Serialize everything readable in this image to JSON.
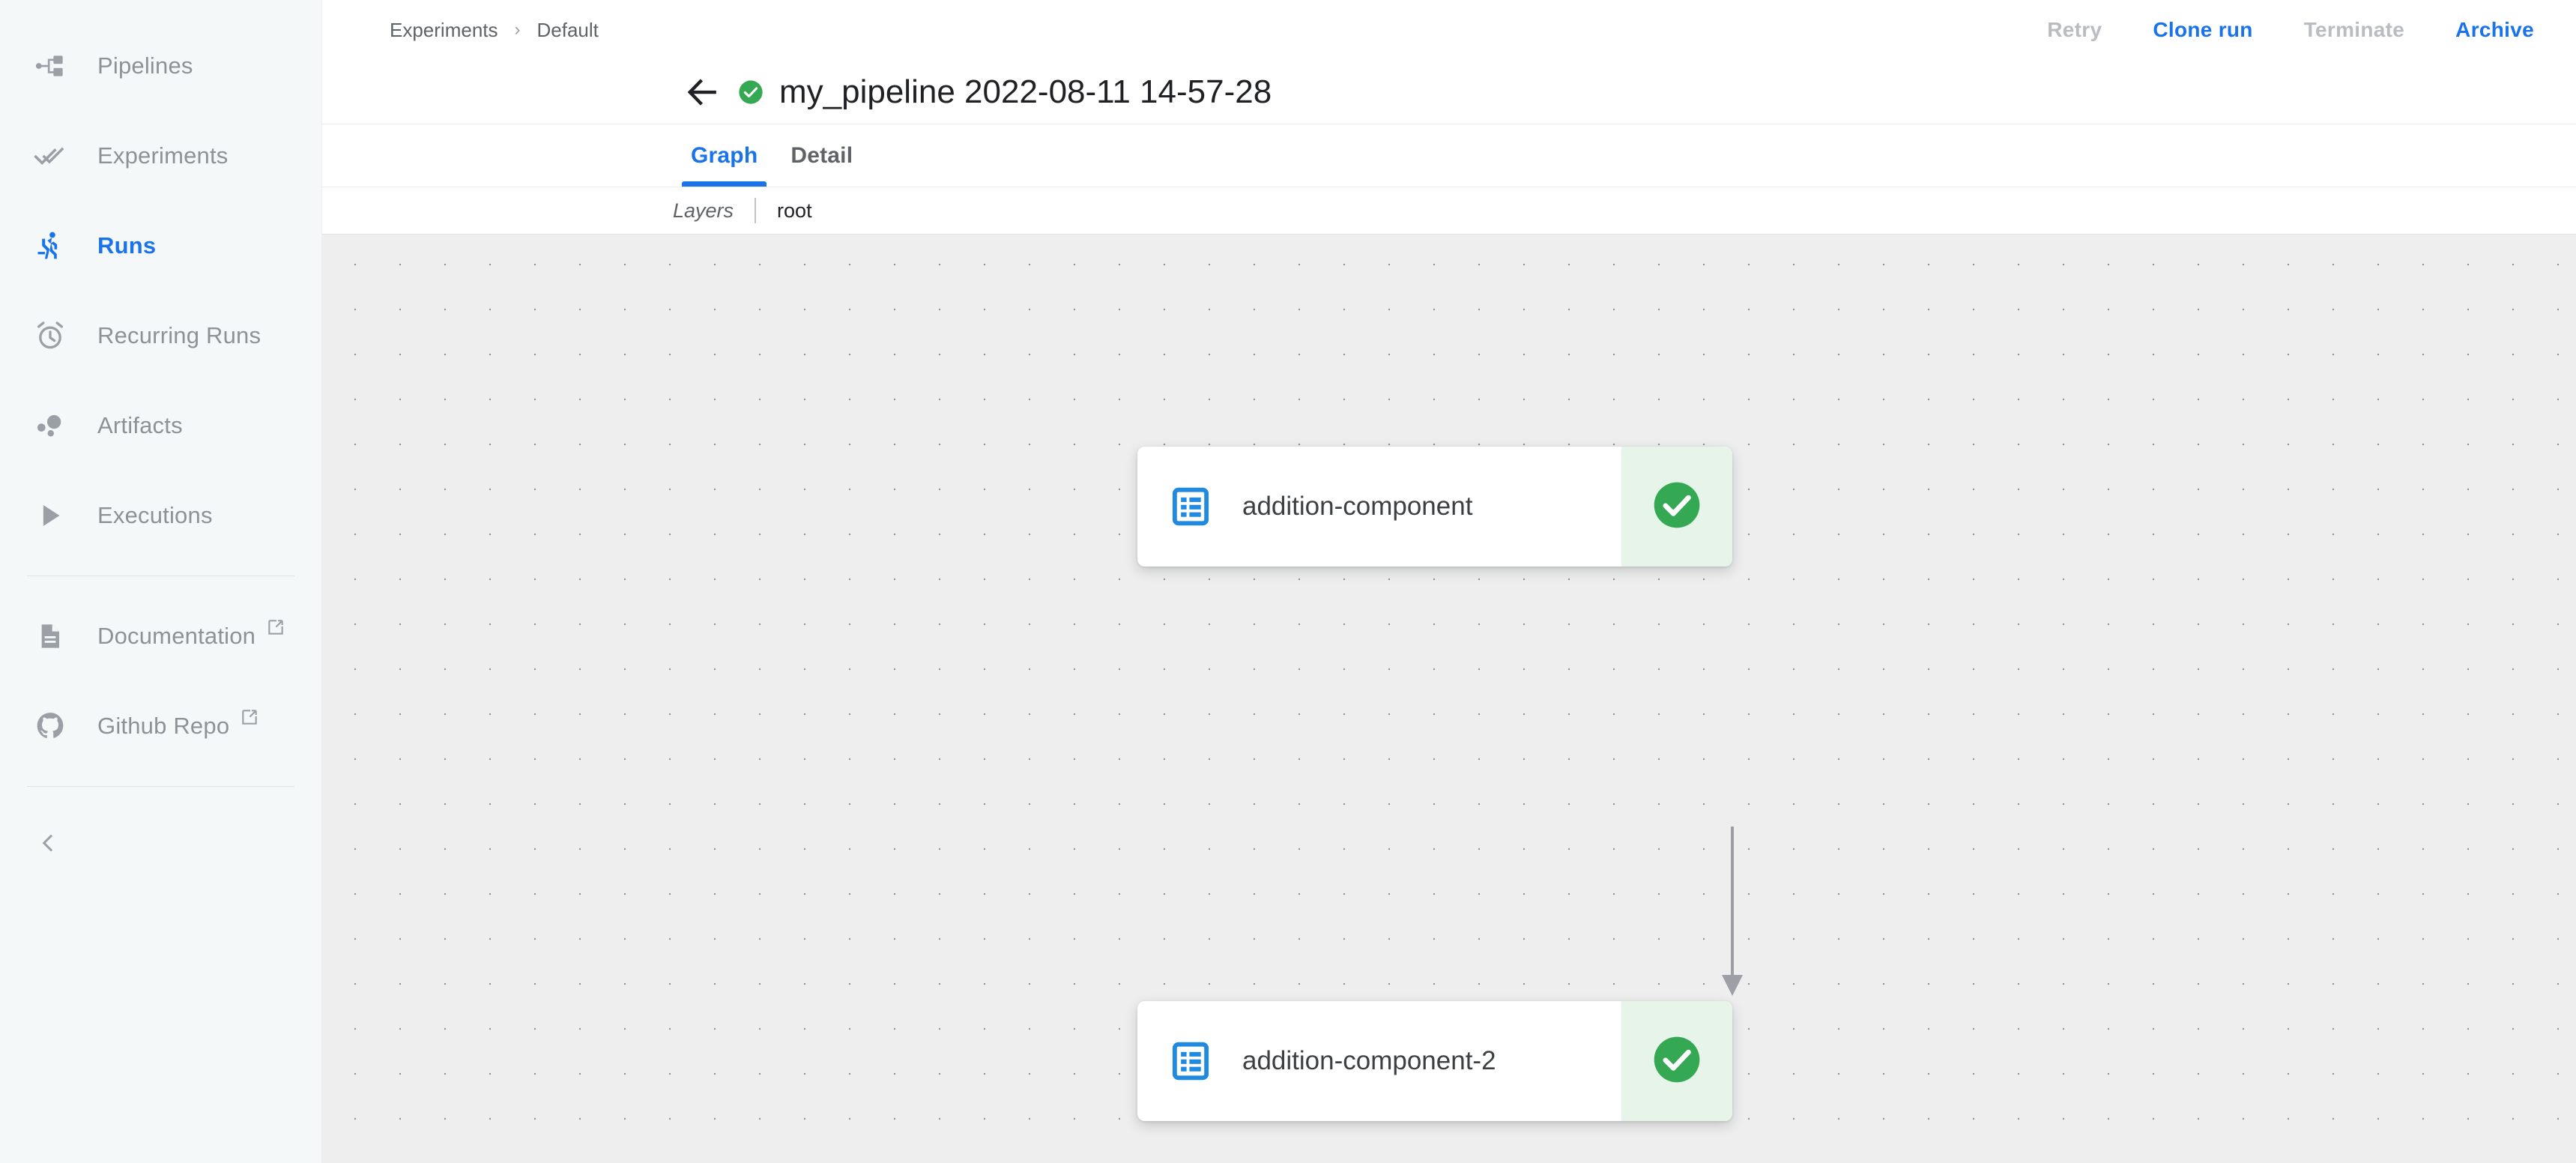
{
  "sidebar": {
    "items": [
      {
        "label": "Pipelines",
        "icon": "account-tree-icon",
        "active": false,
        "external": false
      },
      {
        "label": "Experiments",
        "icon": "double-check-icon",
        "active": false,
        "external": false
      },
      {
        "label": "Runs",
        "icon": "running-person-icon",
        "active": true,
        "external": false
      },
      {
        "label": "Recurring Runs",
        "icon": "alarm-clock-icon",
        "active": false,
        "external": false
      },
      {
        "label": "Artifacts",
        "icon": "bubble-chart-icon",
        "active": false,
        "external": false
      },
      {
        "label": "Executions",
        "icon": "play-triangle-icon",
        "active": false,
        "external": false
      },
      {
        "label": "Documentation",
        "icon": "document-icon",
        "active": false,
        "external": true
      },
      {
        "label": "Github Repo",
        "icon": "github-icon",
        "active": false,
        "external": true
      }
    ],
    "collapse_icon": "chevron-left-icon"
  },
  "topbar": {
    "breadcrumb": [
      {
        "label": "Experiments"
      },
      {
        "label": "Default"
      }
    ],
    "breadcrumb_separator": "›",
    "actions": [
      {
        "label": "Retry",
        "enabled": false
      },
      {
        "label": "Clone run",
        "enabled": true
      },
      {
        "label": "Terminate",
        "enabled": false
      },
      {
        "label": "Archive",
        "enabled": true
      }
    ]
  },
  "title": {
    "back_icon": "arrow-left-icon",
    "status_icon": "success-check-icon",
    "text": "my_pipeline 2022-08-11 14-57-28"
  },
  "tabs": [
    {
      "label": "Graph",
      "active": true
    },
    {
      "label": "Detail",
      "active": false
    }
  ],
  "layers": {
    "label": "Layers",
    "current": "root"
  },
  "graph": {
    "nodes": [
      {
        "label": "addition-component",
        "icon": "task-list-icon",
        "status": "succeeded",
        "status_icon": "success-check-icon"
      },
      {
        "label": "addition-component-2",
        "icon": "task-list-icon",
        "status": "succeeded",
        "status_icon": "success-check-icon"
      }
    ],
    "edges": [
      {
        "from": "addition-component",
        "to": "addition-component-2"
      }
    ]
  },
  "colors": {
    "accent_blue": "#1a73e8",
    "success_green": "#34a853",
    "success_bg": "#e6f4ea",
    "sidebar_bg": "#f4f8f9",
    "canvas_bg": "#eeeeee",
    "muted_text": "#8d9297"
  }
}
